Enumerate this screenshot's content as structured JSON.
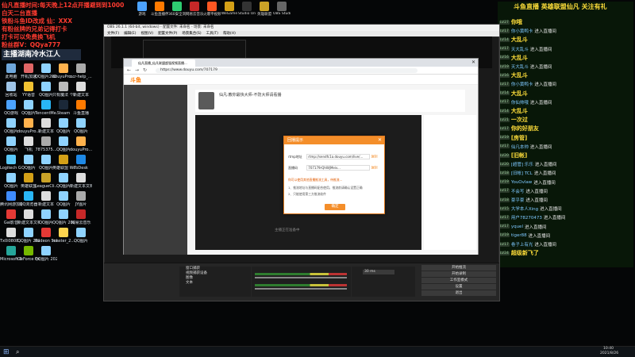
{
  "overlay": {
    "lines": [
      {
        "text": "仙凡直播时间:每天晚上12点开播避到到1000",
        "color": "#ff3b30"
      },
      {
        "text": "白天二台直播",
        "color": "#ff3b30"
      },
      {
        "text": "铁粉斗鱼ID改成 仙：XXX",
        "color": "#ff3b30"
      },
      {
        "text": "有粉丝牌的兄弟记得打卡",
        "color": "#ff3b30"
      },
      {
        "text": "打卡可以免费换飞机",
        "color": "#ff3b30"
      },
      {
        "text": "粉丝群V：QQya777",
        "color": "#ff3b30"
      }
    ],
    "host_tag": "主播湖南冷水江人"
  },
  "desktop_icons": [
    {
      "label": "此电脑",
      "color": "#6fa8dc"
    },
    {
      "label": "开机加速",
      "color": "#e06666"
    },
    {
      "label": "QQ图片2021..",
      "color": "#8fd3ff"
    },
    {
      "label": "douyuPro...",
      "color": "#ffb24d"
    },
    {
      "label": "ocr-help_...",
      "color": "#aaa"
    },
    {
      "label": "回收站",
      "color": "#9fc5e8"
    },
    {
      "label": "YY语音",
      "color": "#f1c232"
    },
    {
      "label": "QQ图片",
      "color": "#8fd3ff"
    },
    {
      "label": "只有魔法 个人",
      "color": "#bbb"
    },
    {
      "label": "新建文本",
      "color": "#ddd"
    },
    {
      "label": "QQ游戏",
      "color": "#4ca3ff"
    },
    {
      "label": "QQ图片",
      "color": "#8fd3ff"
    },
    {
      "label": "TencentMe...",
      "color": "#29b6f6"
    },
    {
      "label": "Steam",
      "color": "#1b2838"
    },
    {
      "label": "斗鱼直播",
      "color": "#ff7a00"
    },
    {
      "label": "QQ图片",
      "color": "#8fd3ff"
    },
    {
      "label": "douyuPro...",
      "color": "#ffb24d"
    },
    {
      "label": "新建文本",
      "color": "#ddd"
    },
    {
      "label": "QQ图片",
      "color": "#8fd3ff"
    },
    {
      "label": "QQ图片",
      "color": "#8fd3ff"
    },
    {
      "label": "QQ图片",
      "color": "#8fd3ff"
    },
    {
      "label": "飞机",
      "color": "#ddd"
    },
    {
      "label": "7875375...",
      "color": "#aaa"
    },
    {
      "label": "QQ图片",
      "color": "#8fd3ff"
    },
    {
      "label": "douyuPro...",
      "color": "#ffb24d"
    },
    {
      "label": "Logitech G HUB",
      "color": "#5ac8fa"
    },
    {
      "label": "QQ图片",
      "color": "#8fd3ff"
    },
    {
      "label": "QQ图片",
      "color": "#8fd3ff"
    },
    {
      "label": "英雄联盟 WeGame",
      "color": "#d4a017"
    },
    {
      "label": "ToDesk",
      "color": "#1e88e5"
    },
    {
      "label": "QQ图片",
      "color": "#8fd3ff"
    },
    {
      "label": "英雄联盟",
      "color": "#d4a017"
    },
    {
      "label": "LeagueCli...",
      "color": "#c9a227"
    },
    {
      "label": "QQ图片",
      "color": "#8fd3ff"
    },
    {
      "label": "新建文本文档",
      "color": "#ddd"
    },
    {
      "label": "腾讯网游加速器",
      "color": "#3f8cff"
    },
    {
      "label": "QQ浏览器",
      "color": "#29b6f6"
    },
    {
      "label": "新建文本",
      "color": "#ddd"
    },
    {
      "label": "QQ图片",
      "color": "#8fd3ff"
    },
    {
      "label": "JY图片",
      "color": "#aaa"
    },
    {
      "label": "Gai影音",
      "color": "#e53935"
    },
    {
      "label": "新建文本文档",
      "color": "#ddd"
    },
    {
      "label": "QQ图片",
      "color": "#8fd3ff"
    },
    {
      "label": "QQ图片 20210823...",
      "color": "#8fd3ff"
    },
    {
      "label": "网易云音乐",
      "color": "#c62828"
    },
    {
      "label": "Tx0i0808...",
      "color": "#ddd"
    },
    {
      "label": "QQ图片 20210823...",
      "color": "#8fd3ff"
    },
    {
      "label": "Radeon Software",
      "color": "#e53935"
    },
    {
      "label": "master_2...",
      "color": "#ffd54f"
    },
    {
      "label": "QQ图片",
      "color": "#8fd3ff"
    },
    {
      "label": "Microsoft Edge",
      "color": "#26a69a"
    },
    {
      "label": "GeForce Experience",
      "color": "#76b900"
    },
    {
      "label": "QQ图片 20210823...",
      "color": "#8fd3ff"
    }
  ],
  "top_icons": [
    {
      "label": "游戏",
      "color": "#4ca3ff"
    },
    {
      "label": "斗鱼直播伴侣",
      "color": "#ff7a00"
    },
    {
      "label": "360安全浏览器",
      "color": "#2ecc71"
    },
    {
      "label": "网易云音乐",
      "color": "#c62828"
    },
    {
      "label": "火爆平视频",
      "color": "#ff5722"
    },
    {
      "label": "WeGame",
      "color": "#d4a017"
    },
    {
      "label": "Studio One",
      "color": "#333"
    },
    {
      "label": "英雄联盟",
      "color": "#c9a227"
    },
    {
      "label": "OBS Studio",
      "color": "#666"
    }
  ],
  "chat": {
    "header": "斗鱼直播 英雄联盟仙凡 关注有礼",
    "rows": [
      {
        "lvl": "LV27",
        "name": "你哦",
        "msg": "",
        "hl": true
      },
      {
        "lvl": "LV17",
        "name": "你小黄鸭卡",
        "msg": "进入直播间"
      },
      {
        "lvl": "LV14",
        "name": "大乱斗",
        "msg": "",
        "hl": true
      },
      {
        "lvl": "LV17",
        "name": "天大乱斗",
        "msg": "进入直播间"
      },
      {
        "lvl": "LV16",
        "name": "大乱斗",
        "msg": "",
        "hl": true
      },
      {
        "lvl": "LV19",
        "name": "天大乱斗",
        "msg": "进入直播间"
      },
      {
        "lvl": "LV16",
        "name": "大乱斗",
        "msg": "",
        "hl": true
      },
      {
        "lvl": "LV17",
        "name": "你小黄鸭卡",
        "msg": "进入直播间"
      },
      {
        "lvl": "LV14",
        "name": "大乱斗",
        "msg": "",
        "hl": true
      },
      {
        "lvl": "LV17",
        "name": "你仙帅哦",
        "msg": "进入直播间"
      },
      {
        "lvl": "LV14",
        "name": "大乱斗",
        "msg": "",
        "hl": true
      },
      {
        "lvl": "LV21",
        "name": "一次过",
        "msg": "",
        "hl": true
      },
      {
        "lvl": "LV17",
        "name": "你的好朋友",
        "msg": "",
        "hl": true
      },
      {
        "lvl": "LV19",
        "name": "[房管]",
        "msg": "",
        "hl": true
      },
      {
        "lvl": "LV17",
        "name": "仙凡本帅",
        "msg": "进入直播间"
      },
      {
        "lvl": "LV20",
        "name": "[旧帐]",
        "msg": "",
        "hl": true
      },
      {
        "lvl": "LV20",
        "name": "[超管] 乐乐",
        "msg": "进入直播间"
      },
      {
        "lvl": "LV18",
        "name": "[旧帐] TCL",
        "msg": "进入直播间"
      },
      {
        "lvl": "LV19",
        "name": "YouOvlaw",
        "msg": "进入直播间"
      },
      {
        "lvl": "LV17",
        "name": "不会写",
        "msg": "进入直播间"
      },
      {
        "lvl": "LV18",
        "name": "豪乎豪",
        "msg": "进入直播间"
      },
      {
        "lvl": "LV15",
        "name": "大学本人Xing",
        "msg": "进入直播间"
      },
      {
        "lvl": "LV17",
        "name": "用户78270473",
        "msg": "进入直播间"
      },
      {
        "lvl": "LV17",
        "name": "yquel",
        "msg": "进入直播间"
      },
      {
        "lvl": "LV19",
        "name": "tiger88",
        "msg": "进入直播间"
      },
      {
        "lvl": "LV17",
        "name": "卷子上有光",
        "msg": "进入直播间"
      },
      {
        "lvl": "LV24",
        "name": "超级新飞了",
        "msg": "",
        "hl": true
      }
    ]
  },
  "obs": {
    "title": "OBS 26.1.1 (64-bit, windows) - 配置文件: 未命名 - 场景: 未命名",
    "menu": [
      "文件(F)",
      "编辑(E)",
      "视图(V)",
      "配置文件(P)",
      "场景集合(S)",
      "工具(T)",
      "帮助(H)"
    ],
    "sources": [
      "窗口捕获",
      "视频捕获设备",
      "图像",
      "文本"
    ],
    "controls": [
      "开始推流",
      "开始录制",
      "工作室模式",
      "设置",
      "退出"
    ],
    "time": "30 ms"
  },
  "browser": {
    "tab": "仙凡直播_仙凡联盟超强视频直播...",
    "url": "https://www.douyu.com/707179",
    "site_name": "斗鱼",
    "room_title": "仙凡:教你最快大师-不防大师请看播",
    "live_text": "主播正在准备中",
    "toolbar_items": [
      "网页游戏",
      "直播互动",
      "付费直播",
      "斗鱼游戏"
    ]
  },
  "dialog": {
    "title": "回播提示",
    "row1_label": "rtmp地址",
    "row1_value": "rtmp://sendfc1a.douyu.com/live/...",
    "row1_action": "复制",
    "row2_label": "直播码",
    "row2_value": "707179rQhWjMeiv...",
    "row2_action": "复制",
    "note1": "你可以使用其他直播推流工具，待推流...",
    "note2": "1、推流地址与直播码配合使用，推流前请确认设置正确",
    "note3": "2、只能使用第三方推流软件",
    "button": "确定"
  },
  "taskbar": {
    "clock": "10:40",
    "date": "2021/8/26"
  }
}
